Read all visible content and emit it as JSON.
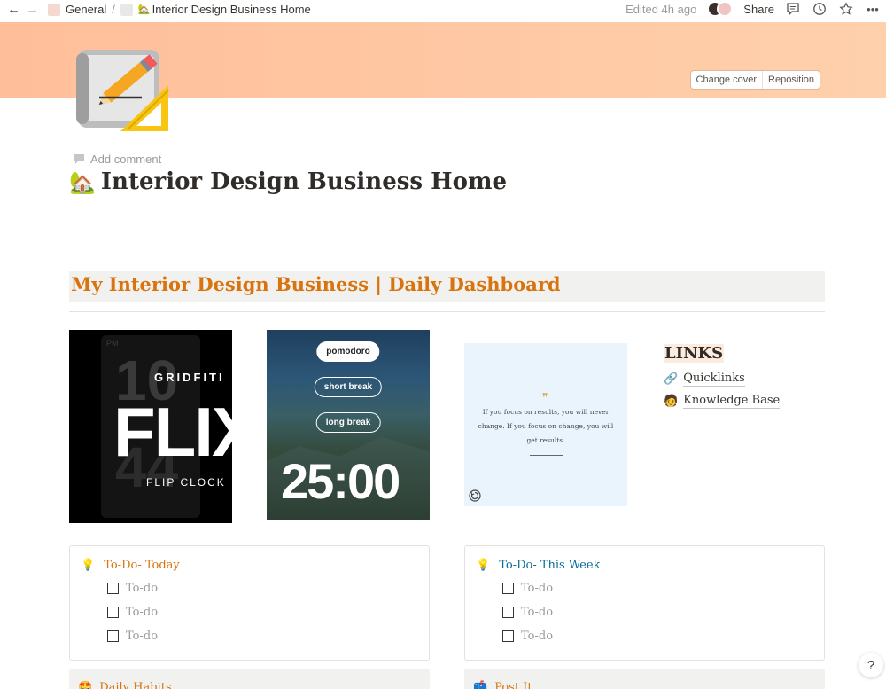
{
  "topbar": {
    "breadcrumb_workspace": "General",
    "breadcrumb_page": "Interior Design Business Home",
    "edited": "Edited 4h ago",
    "share": "Share"
  },
  "cover": {
    "change_cover": "Change cover",
    "reposition": "Reposition",
    "gradient_colors": [
      "#ffbe9a",
      "#ffd0ac"
    ]
  },
  "page": {
    "add_comment": "Add comment",
    "title": "Interior Design Business Home",
    "title_emoji": "🏡",
    "section_title": "My Interior Design Business | Daily Dashboard"
  },
  "flip_clock": {
    "pm": "PM",
    "hour": "10",
    "minute": "44",
    "brand": "GRIDFITI",
    "logo": "FLIX",
    "label": "FLIP CLOCK"
  },
  "pomodoro": {
    "buttons": [
      "pomodoro",
      "short break",
      "long break"
    ],
    "active": "pomodoro",
    "time": "25:00"
  },
  "quote": {
    "mark": "❞",
    "text": "If you focus on results, you will never change. If you focus on change, you will get results."
  },
  "links": {
    "heading": "LINKS",
    "items": [
      {
        "emoji": "🔗",
        "label": "Quicklinks"
      },
      {
        "emoji": "🧑",
        "label": "Knowledge Base"
      }
    ]
  },
  "todo_today": {
    "emoji": "💡",
    "title": "To-Do- Today",
    "items": [
      "To-do",
      "To-do",
      "To-do"
    ]
  },
  "todo_week": {
    "emoji": "💡",
    "title": "To-Do- This Week",
    "items": [
      "To-do",
      "To-do",
      "To-do"
    ]
  },
  "daily_habits": {
    "emoji": "🤩",
    "title": "Daily Habits"
  },
  "post_it": {
    "emoji": "📫",
    "title": "Post It"
  },
  "help": "?"
}
